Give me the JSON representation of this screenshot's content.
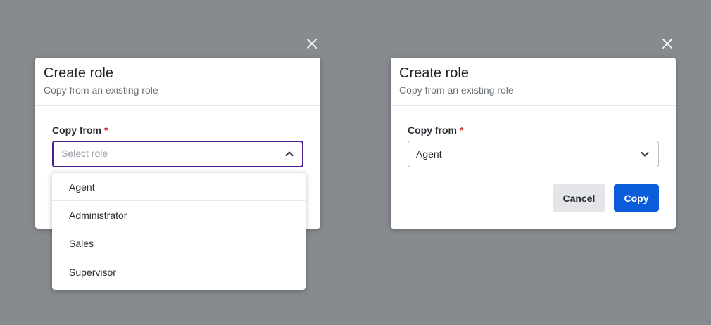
{
  "colors": {
    "backdrop": "#878b8f",
    "primary": "#0b5cdb",
    "focus_border": "#4a1f8f",
    "required": "#d0312d"
  },
  "left_modal": {
    "close_icon": "close-icon",
    "title": "Create role",
    "subtitle": "Copy from an existing role",
    "field_label": "Copy from",
    "required_marker": "*",
    "select_placeholder": "Select role",
    "chevron_icon": "chevron-up-icon",
    "dropdown_options": [
      "Agent",
      "Administrator",
      "Sales",
      "Supervisor"
    ]
  },
  "right_modal": {
    "close_icon": "close-icon",
    "title": "Create role",
    "subtitle": "Copy from an existing role",
    "field_label": "Copy from",
    "required_marker": "*",
    "select_value": "Agent",
    "chevron_icon": "chevron-down-icon",
    "cancel_label": "Cancel",
    "copy_label": "Copy"
  }
}
